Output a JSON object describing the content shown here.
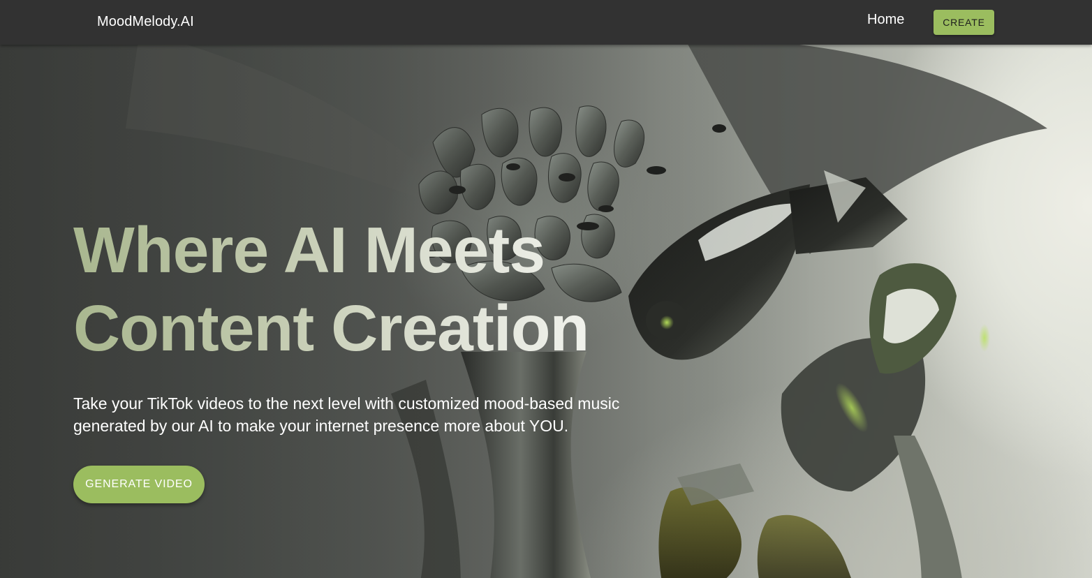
{
  "nav": {
    "brand": "MoodMelody.AI",
    "links": [
      {
        "label": "Home"
      }
    ],
    "create_label": "CREATE"
  },
  "hero": {
    "headline_line1": "Where AI Meets",
    "headline_line2": "Content Creation",
    "subtitle": "Take your TikTok videos to the next level with customized mood-based music generated by our AI to make your internet presence more about YOU.",
    "cta_label": "GENERATE VIDEO",
    "background_image": "abstract-metallic-flower-image"
  },
  "colors": {
    "navbar": "#323232",
    "accent_green": "#9bbd5f",
    "text": "#ffffff"
  }
}
